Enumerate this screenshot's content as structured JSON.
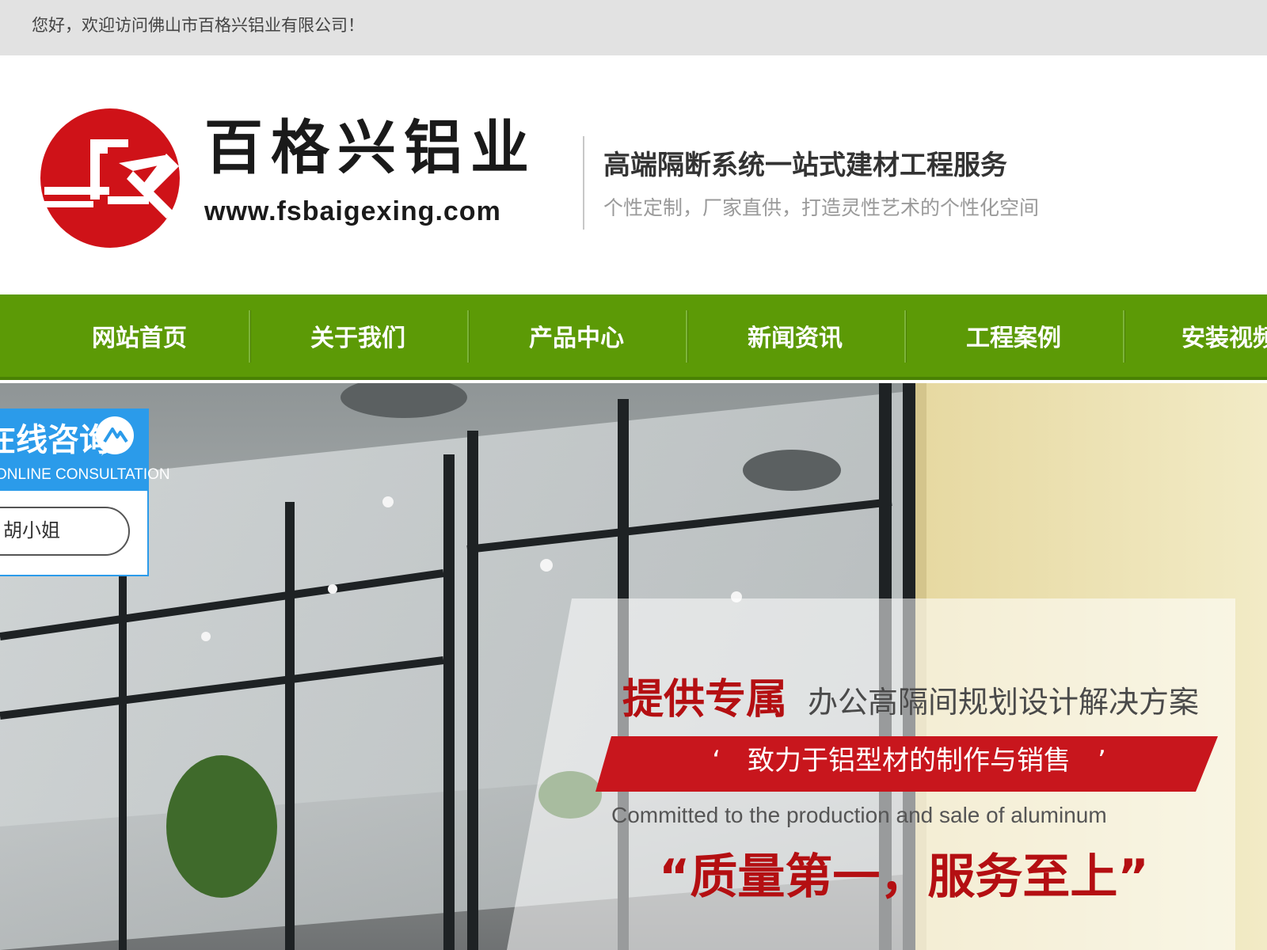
{
  "topbar": {
    "welcome": "您好，欢迎访问佛山市百格兴铝业有限公司！"
  },
  "header": {
    "brand_name": "百格兴铝业",
    "brand_url": "www.fsbaigexing.com",
    "slogan_main": "高端隔断系统一站式建材工程服务",
    "slogan_sub": "个性定制，厂家直供，打造灵性艺术的个性化空间",
    "logo_icon": "company-logo-icon"
  },
  "nav": {
    "items": [
      {
        "label": "网站首页"
      },
      {
        "label": "关于我们"
      },
      {
        "label": "产品中心"
      },
      {
        "label": "新闻资讯"
      },
      {
        "label": "工程案例"
      },
      {
        "label": "安装视频"
      }
    ]
  },
  "banner": {
    "headline": "提供专属",
    "headline_sub": "办公高隔间规划设计解决方案",
    "ribbon": "‘　致力于铝型材的制作与销售　’",
    "english": "Committed to the production and sale of aluminum",
    "quote": "“质量第一，服务至上”"
  },
  "consult": {
    "title": "在线咨询",
    "subtitle": "ONLINE CONSULTATION",
    "agent": "胡小姐",
    "icon": "chat-bubble-icon"
  },
  "colors": {
    "nav_green": "#5c9a06",
    "brand_red": "#c8161d",
    "consult_blue": "#2b9bea"
  }
}
